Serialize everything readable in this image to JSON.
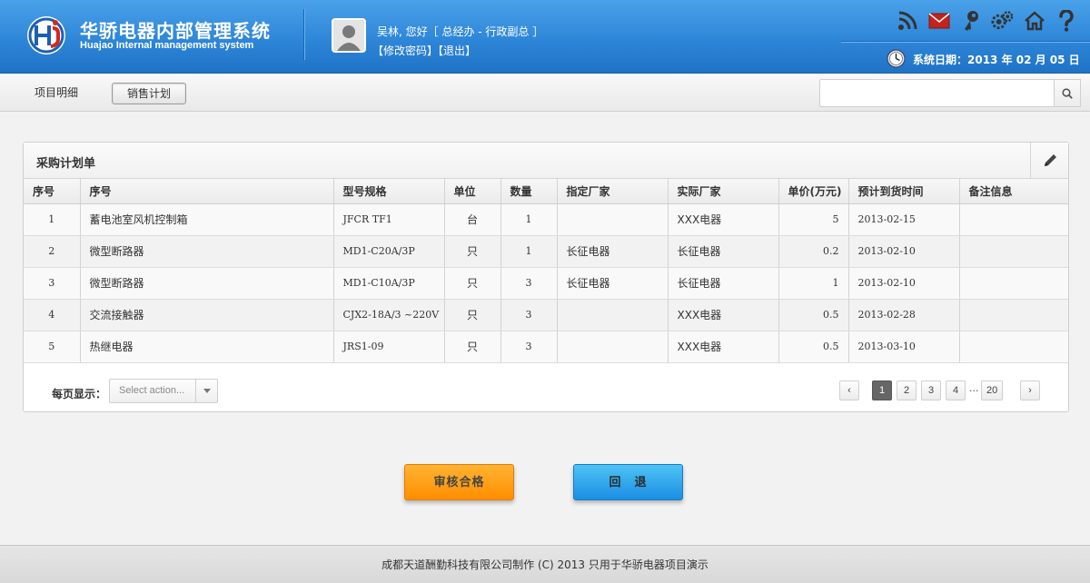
{
  "header": {
    "app_title": "华骄电器内部管理系统",
    "app_subtitle": "Huajao Internal management system",
    "user_greeting": "吴林, 您好［ 总经办 - 行政副总 ］",
    "change_password": "【修改密码】",
    "logout": "【退出】",
    "system_date": "系统日期：2013 年 02 月 05 日",
    "icons": [
      "rss-icon",
      "mail-icon",
      "key-icon",
      "settings-icon",
      "home-icon",
      "help-icon"
    ]
  },
  "tabs": [
    {
      "label": "项目明细",
      "active": false
    },
    {
      "label": "销售计划",
      "active": true
    }
  ],
  "search": {
    "placeholder": ""
  },
  "panel": {
    "title": "采购计划单",
    "columns": [
      "序号",
      "序号",
      "型号规格",
      "单位",
      "数量",
      "指定厂家",
      "实际厂家",
      "单价(万元)",
      "预计到货时间",
      "备注信息"
    ],
    "rows": [
      {
        "no": "1",
        "name": "蓄电池室风机控制箱",
        "model": "JFCR TF1",
        "unit": "台",
        "qty": "1",
        "designated_maker": "",
        "actual_maker": "XXX电器",
        "price": "5",
        "eta": "2013-02-15",
        "remark": ""
      },
      {
        "no": "2",
        "name": "微型断路器",
        "model": "MD1-C20A/3P",
        "unit": "只",
        "qty": "1",
        "designated_maker": "长征电器",
        "actual_maker": "长征电器",
        "price": "0.2",
        "eta": "2013-02-10",
        "remark": ""
      },
      {
        "no": "3",
        "name": "微型断路器",
        "model": "MD1-C10A/3P",
        "unit": "只",
        "qty": "3",
        "designated_maker": "长征电器",
        "actual_maker": "长征电器",
        "price": "1",
        "eta": "2013-02-10",
        "remark": ""
      },
      {
        "no": "4",
        "name": "交流接触器",
        "model": "CJX2-18A/3 ~220V",
        "unit": "只",
        "qty": "3",
        "designated_maker": "",
        "actual_maker": "XXX电器",
        "price": "0.5",
        "eta": "2013-02-28",
        "remark": ""
      },
      {
        "no": "5",
        "name": "热继电器",
        "model": "JRS1-09",
        "unit": "只",
        "qty": "3",
        "designated_maker": "",
        "actual_maker": "XXX电器",
        "price": "0.5",
        "eta": "2013-03-10",
        "remark": ""
      }
    ]
  },
  "pager": {
    "per_page_label": "每页显示：",
    "select_value": "Select action...",
    "prev": "‹",
    "next": "›",
    "pages": [
      "1",
      "2",
      "3",
      "4"
    ],
    "ellipsis": "...",
    "last_page": "20",
    "current": "1"
  },
  "actions": {
    "approve": "审核合格",
    "back": "回　退"
  },
  "footer": {
    "text": "成都天道酬勤科技有限公司制作 (C) 2013 只用于华骄电器项目演示"
  },
  "colors": {
    "header_blue": "#2e86d8",
    "approve_orange": "#ff9a10",
    "back_blue": "#2aa3ea"
  }
}
